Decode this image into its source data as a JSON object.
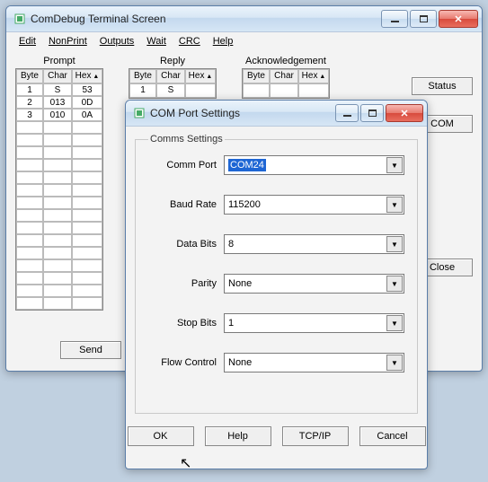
{
  "main_window": {
    "title": "ComDebug Terminal Screen",
    "menu": [
      "Edit",
      "NonPrint",
      "Outputs",
      "Wait",
      "CRC",
      "Help"
    ],
    "sections": {
      "prompt": {
        "label": "Prompt",
        "headers": [
          "Byte",
          "Char",
          "Hex"
        ],
        "rows": [
          {
            "byte": "1",
            "char": "S",
            "hex": "53"
          },
          {
            "byte": "2",
            "char": "013",
            "hex": "0D"
          },
          {
            "byte": "3",
            "char": "010",
            "hex": "0A"
          }
        ],
        "blank_rows": 15
      },
      "reply": {
        "label": "Reply",
        "headers": [
          "Byte",
          "Char",
          "Hex"
        ],
        "rows": [
          {
            "byte": "1",
            "char": "S",
            "hex": ""
          }
        ]
      },
      "ack": {
        "label": "Acknowledgement",
        "headers": [
          "Byte",
          "Char",
          "Hex"
        ],
        "rows": [
          {
            "byte": "",
            "char": "",
            "hex": ""
          }
        ]
      }
    },
    "buttons": {
      "status": "Status",
      "com": "COM",
      "close": "Close",
      "send": "Send"
    }
  },
  "dialog": {
    "title": "COM Port Settings",
    "legend": "Comms Settings",
    "fields": {
      "comm_port": {
        "label": "Comm Port",
        "value": "COM24"
      },
      "baud_rate": {
        "label": "Baud Rate",
        "value": "115200"
      },
      "data_bits": {
        "label": "Data Bits",
        "value": "8"
      },
      "parity": {
        "label": "Parity",
        "value": "None"
      },
      "stop_bits": {
        "label": "Stop Bits",
        "value": "1"
      },
      "flow_control": {
        "label": "Flow Control",
        "value": "None"
      }
    },
    "buttons": {
      "ok": "OK",
      "help": "Help",
      "tcpip": "TCP/IP",
      "cancel": "Cancel"
    }
  }
}
